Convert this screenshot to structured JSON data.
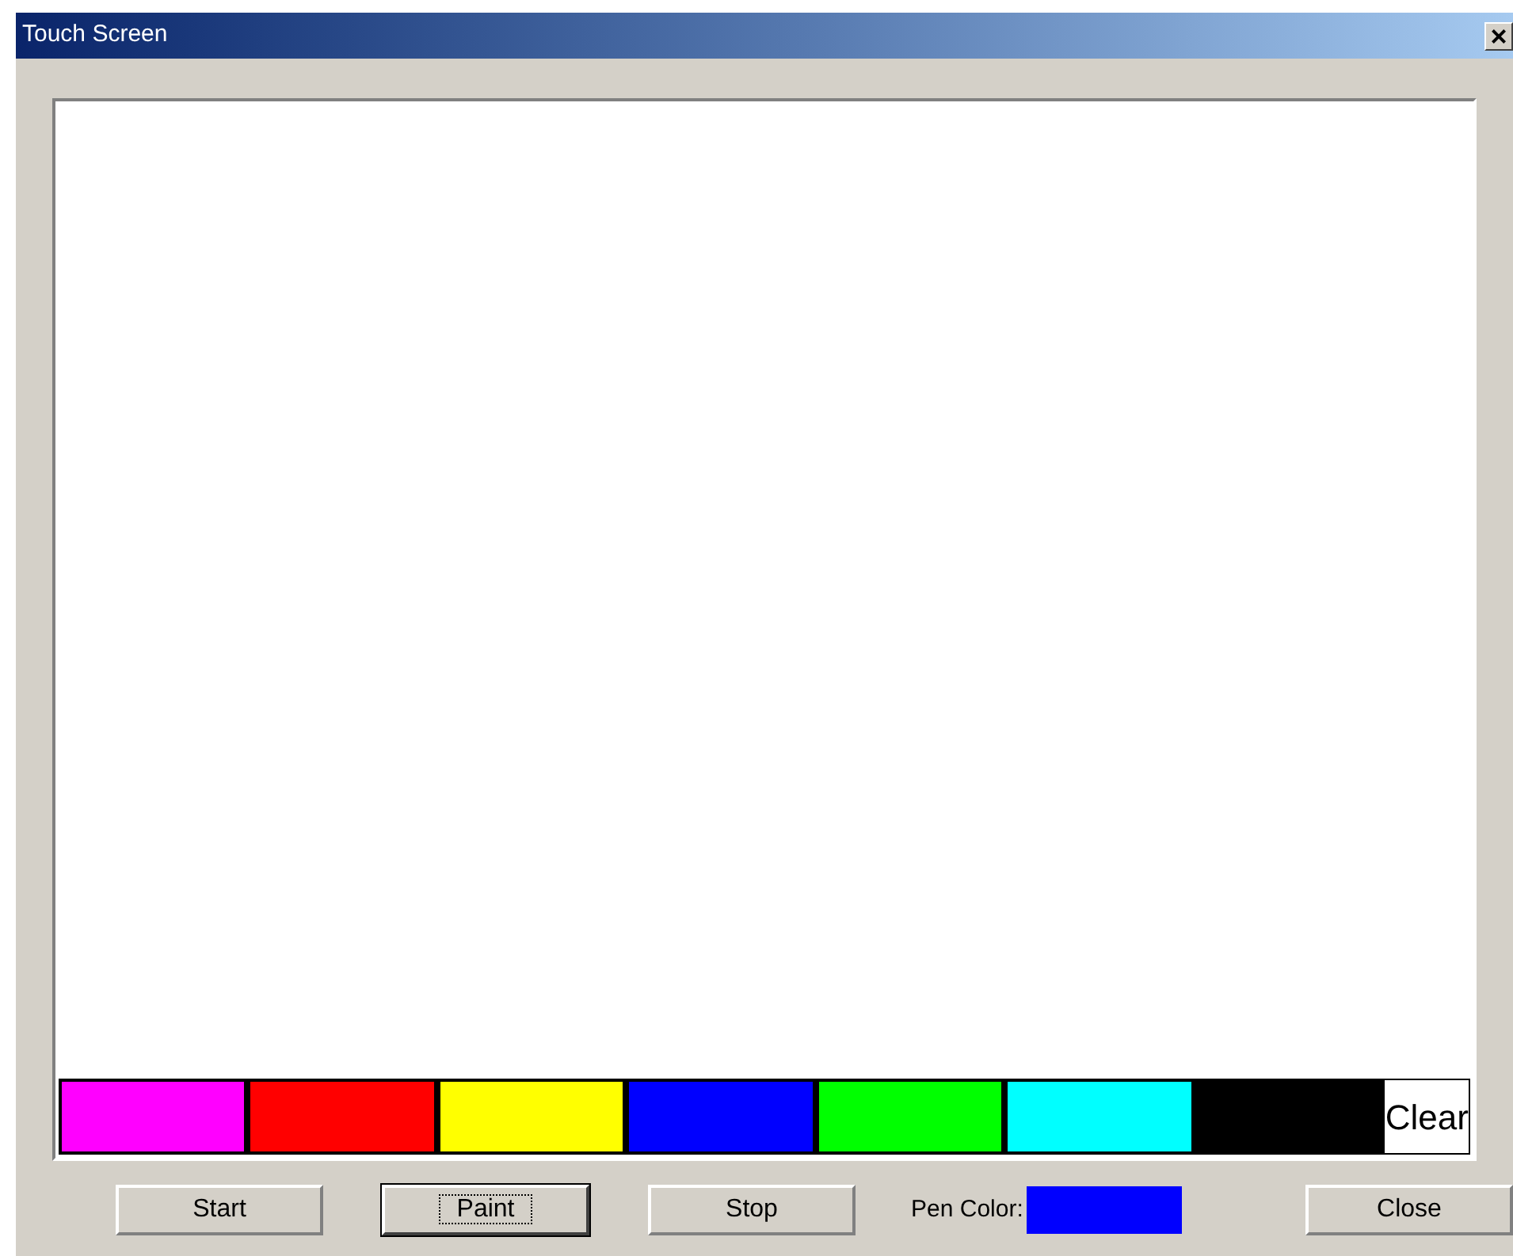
{
  "window": {
    "title": "Touch Screen",
    "close": "×"
  },
  "palette": [
    {
      "kind": "swatch",
      "color": "#ff00ff"
    },
    {
      "kind": "swatch",
      "color": "#ff0000"
    },
    {
      "kind": "swatch",
      "color": "#ffff00"
    },
    {
      "kind": "swatch",
      "color": "#0000ff"
    },
    {
      "kind": "swatch",
      "color": "#00ff00"
    },
    {
      "kind": "swatch",
      "color": "#00ffff"
    },
    {
      "kind": "swatch",
      "color": "#000000"
    },
    {
      "kind": "button",
      "label": "Clear"
    }
  ],
  "buttons": [
    {
      "label": "Start",
      "focused": false
    },
    {
      "label": "Paint",
      "focused": true
    },
    {
      "label": "Stop",
      "focused": false
    }
  ],
  "pen_color": {
    "label": "Pen Color:",
    "color": "#0000ff"
  },
  "close_button": {
    "label": "Close",
    "focused": false
  }
}
